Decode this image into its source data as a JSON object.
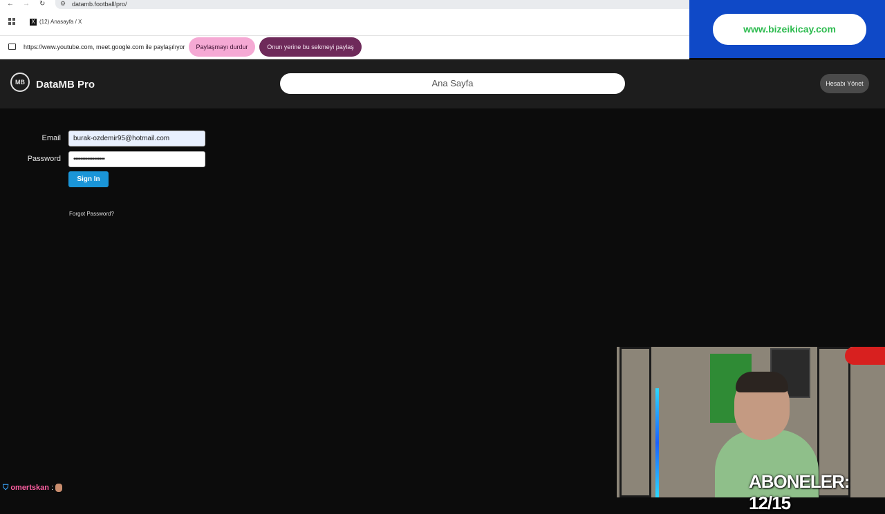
{
  "browser": {
    "url": "datamb.football/pro/",
    "tab_label": "(12) Anasayfa / X",
    "tab_icon": "x-logo-icon",
    "sharing_notice": "https://www.youtube.com, meet.google.com ile paylaşılıyor",
    "stop_sharing_label": "Paylaşmayı durdur",
    "share_this_tab_label": "Onun yerine bu sekmeyi paylaş"
  },
  "sponsor": {
    "text": "www.bizeikicay.com"
  },
  "app": {
    "logo_text": "MB",
    "brand": "DataMB Pro",
    "home_label": "Ana Sayfa",
    "account_label": "Hesabı Yönet"
  },
  "login": {
    "email_label": "Email",
    "email_value": "burak-ozdemir95@hotmail.com",
    "password_label": "Password",
    "password_value": "••••••••••••••••••",
    "signin_label": "Sign In",
    "forgot_label": "Forgot Password?"
  },
  "overlay": {
    "subscribers_text": "ABONELER: 12/15",
    "chat_username": "omertskan",
    "chat_separator": ":"
  },
  "colors": {
    "accent_blue": "#1a95d8",
    "sponsor_blue": "#0f49c7",
    "stop_pink": "#f5a9d4",
    "share_purple": "#6e2a5a",
    "header_bg": "#1d1d1d",
    "page_bg": "#0c0c0c"
  }
}
